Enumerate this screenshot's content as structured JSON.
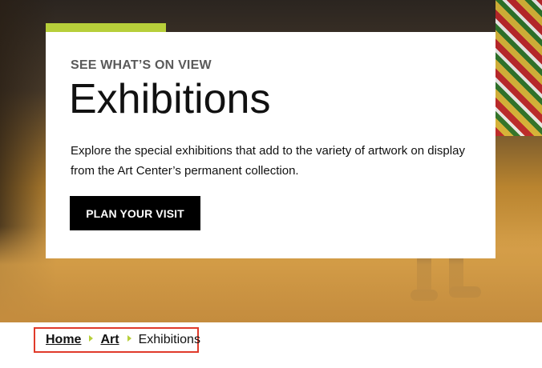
{
  "hero": {
    "eyebrow": "SEE WHAT’S ON VIEW",
    "title": "Exhibitions",
    "description": "Explore the special exhibitions that add to the variety of artwork on display from the Art Center’s permanent collection.",
    "cta_label": "PLAN YOUR VISIT"
  },
  "breadcrumb": {
    "items": [
      {
        "label": "Home"
      },
      {
        "label": "Art"
      }
    ],
    "current": "Exhibitions"
  },
  "colors": {
    "accent": "#b7cf3a",
    "highlight_border": "#e03a2a",
    "button_bg": "#000000"
  },
  "icons": {
    "breadcrumb_separator": "caret-right-icon"
  }
}
